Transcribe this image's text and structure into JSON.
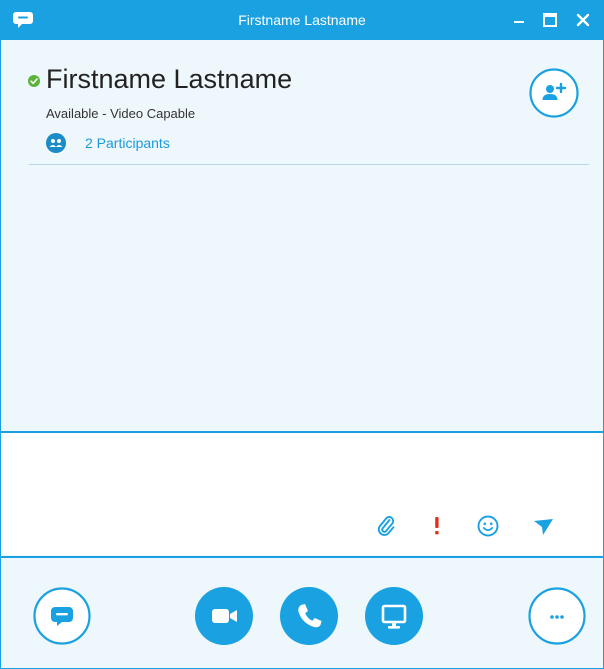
{
  "window": {
    "title": "Firstname Lastname",
    "accent_color": "#1aa1e1",
    "background_color": "#eef7fc",
    "presence_color": "#5bb33a",
    "urgent_color": "#e0301e"
  },
  "contact": {
    "name": "Firstname Lastname",
    "status": "Available - Video Capable",
    "participants_label": "2 Participants"
  },
  "compose": {
    "placeholder": ""
  },
  "icons": {
    "app": "chat-bubble-icon",
    "minimize": "minimize-icon",
    "maximize": "maximize-icon",
    "close": "close-icon",
    "add_person": "add-person-icon",
    "participants": "participants-icon",
    "attach": "paperclip-icon",
    "importance": "exclamation-icon",
    "emoticon": "smiley-icon",
    "send": "send-arrow-icon",
    "im": "chat-bubble-icon",
    "video": "video-camera-icon",
    "call": "phone-icon",
    "present": "monitor-icon",
    "more": "more-options-icon"
  }
}
